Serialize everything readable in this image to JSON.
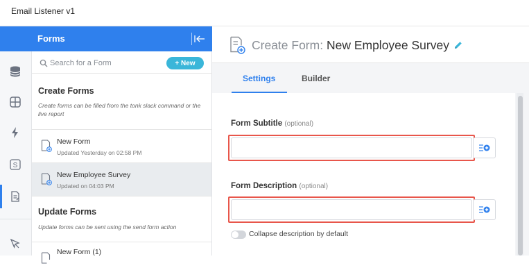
{
  "app": {
    "title": "Email Listener v1"
  },
  "rail": {
    "icons": [
      "database-icon",
      "grid-icon",
      "bolt-icon",
      "s-badge-icon",
      "form-icon",
      "cursor-icon"
    ],
    "accent": "#2f80ed"
  },
  "panel": {
    "title": "Forms",
    "search": {
      "placeholder": "Search for a Form",
      "value": ""
    },
    "new_button": "+ New",
    "create_section": {
      "title": "Create Forms",
      "description": "Create forms can be filled from the tonk slack command or the live report"
    },
    "create_items": [
      {
        "name": "New Form",
        "meta": "Updated Yesterday on 02:58 PM",
        "selected": false
      },
      {
        "name": "New Employee Survey",
        "meta": "Updated on 04:03 PM",
        "selected": true
      }
    ],
    "update_section": {
      "title": "Update Forms",
      "description": "Update forms can be sent using the send form action"
    },
    "update_items": [
      {
        "name": "New Form (1)"
      }
    ]
  },
  "main": {
    "header": {
      "prefix": "Create Form:",
      "name": "New Employee Survey"
    },
    "tabs": [
      {
        "label": "Settings",
        "active": true
      },
      {
        "label": "Builder",
        "active": false
      }
    ],
    "fields": [
      {
        "label": "Form Subtitle",
        "optional": "(optional)",
        "value": "",
        "highlighted": true
      },
      {
        "label": "Form Description",
        "optional": "(optional)",
        "value": "",
        "highlighted": true
      }
    ],
    "collapse_toggle": {
      "label": "Collapse description by default",
      "on": false
    }
  },
  "colors": {
    "accent": "#2f80ed",
    "new_button": "#3ab6d9",
    "highlight": "#e8564b"
  }
}
